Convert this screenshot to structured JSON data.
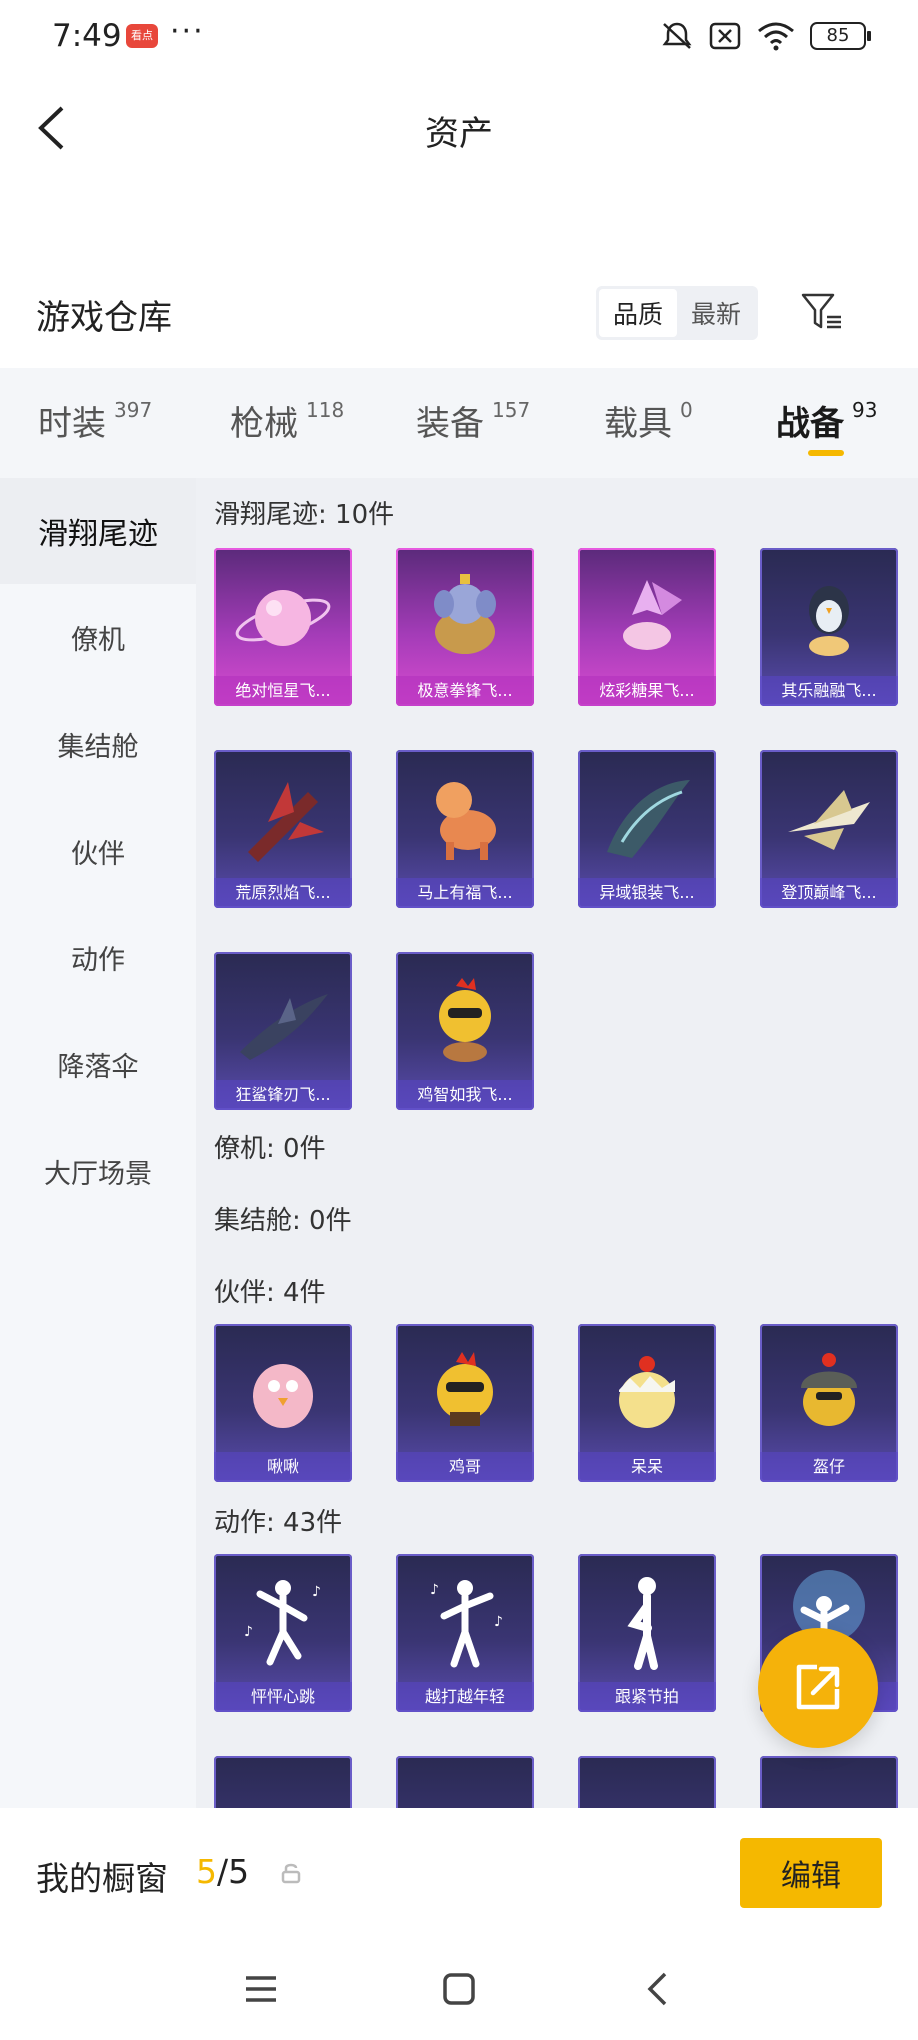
{
  "status": {
    "time": "7:49",
    "app_badge": "看点",
    "more": "···",
    "battery": "85"
  },
  "header": {
    "title": "资产"
  },
  "warehouse": {
    "title": "游戏仓库",
    "sort_options": [
      "品质",
      "最新"
    ],
    "sort_active": "品质"
  },
  "tabs": [
    {
      "label": "时装",
      "count": "397"
    },
    {
      "label": "枪械",
      "count": "118"
    },
    {
      "label": "装备",
      "count": "157"
    },
    {
      "label": "载具",
      "count": "0"
    },
    {
      "label": "战备",
      "count": "93",
      "active": true
    }
  ],
  "sidebar": {
    "items": [
      "滑翔尾迹",
      "僚机",
      "集结舱",
      "伙伴",
      "动作",
      "降落伞",
      "大厅场景"
    ],
    "active": "滑翔尾迹"
  },
  "sections": {
    "glide": {
      "title": "滑翔尾迹: 10件",
      "items": [
        {
          "name": "绝对恒星飞...",
          "rarity": "pink",
          "icon": "planet-icon"
        },
        {
          "name": "极意拳锋飞...",
          "rarity": "pink",
          "icon": "elephant-icon"
        },
        {
          "name": "炫彩糖果飞...",
          "rarity": "pink",
          "icon": "candy-icon"
        },
        {
          "name": "其乐融融飞...",
          "rarity": "purple",
          "icon": "penguin-icon"
        },
        {
          "name": "荒原烈焰飞...",
          "rarity": "purple",
          "icon": "flame-glider-icon"
        },
        {
          "name": "马上有福飞...",
          "rarity": "purple",
          "icon": "horse-icon"
        },
        {
          "name": "异域银装飞...",
          "rarity": "purple",
          "icon": "wing-icon"
        },
        {
          "name": "登顶巅峰飞...",
          "rarity": "purple",
          "icon": "jet-icon"
        },
        {
          "name": "狂鲨锋刃飞...",
          "rarity": "purple",
          "icon": "shark-icon"
        },
        {
          "name": "鸡智如我飞...",
          "rarity": "purple",
          "icon": "chicken-icon"
        }
      ]
    },
    "wingman": {
      "title": "僚机: 0件"
    },
    "rally": {
      "title": "集结舱: 0件"
    },
    "companion": {
      "title": "伙伴: 4件",
      "items": [
        {
          "name": "啾啾",
          "rarity": "purple",
          "icon": "pink-chick-icon"
        },
        {
          "name": "鸡哥",
          "rarity": "purple",
          "icon": "chicken-icon"
        },
        {
          "name": "呆呆",
          "rarity": "purple",
          "icon": "egg-chick-icon"
        },
        {
          "name": "盔仔",
          "rarity": "purple",
          "icon": "helmet-chick-icon"
        }
      ]
    },
    "emote": {
      "title": "动作: 43件",
      "items": [
        {
          "name": "怦怦心跳",
          "rarity": "purple",
          "icon": "dance-pose-icon"
        },
        {
          "name": "越打越年轻",
          "rarity": "purple",
          "icon": "dance-pose-icon"
        },
        {
          "name": "跟紧节拍",
          "rarity": "purple",
          "icon": "dance-pose-icon"
        },
        {
          "name": "",
          "rarity": "purple",
          "icon": "stage-pose-icon"
        }
      ]
    }
  },
  "window": {
    "label": "我的橱窗",
    "current": "5",
    "total": "/5",
    "edit_label": "编辑"
  },
  "colors": {
    "accent": "#f5b800",
    "pink_card": "#d94cd0",
    "purple_card": "#5a4cae"
  }
}
